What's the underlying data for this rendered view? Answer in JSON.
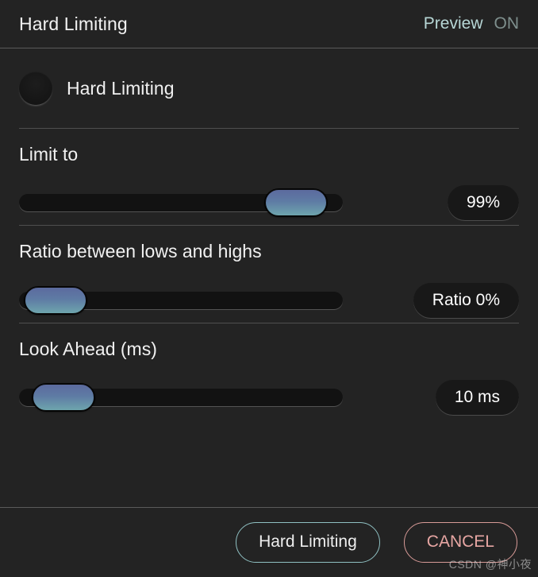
{
  "header": {
    "title": "Hard Limiting",
    "preview_label": "Preview",
    "preview_state": "ON"
  },
  "toggle": {
    "label": "Hard Limiting",
    "state": "off"
  },
  "sections": [
    {
      "title": "Limit to",
      "value_label": "99%",
      "slider_percent": 94
    },
    {
      "title": "Ratio between lows and highs",
      "value_label": "Ratio 0%",
      "slider_percent": 2
    },
    {
      "title": "Look Ahead (ms)",
      "value_label": "10 ms",
      "slider_percent": 5
    }
  ],
  "footer": {
    "confirm_label": "Hard Limiting",
    "cancel_label": "CANCEL"
  },
  "watermark": "CSDN @神小夜",
  "colors": {
    "background": "#232323",
    "track": "#121212",
    "thumb_top": "#5c6a9e",
    "thumb_bottom": "#6ea5ad",
    "accent_preview": "#b7d7d6",
    "confirm_border": "#8fc0c2",
    "cancel_border": "#d79a97",
    "cancel_text": "#e7a6a3",
    "divider": "#4f4f4f"
  }
}
